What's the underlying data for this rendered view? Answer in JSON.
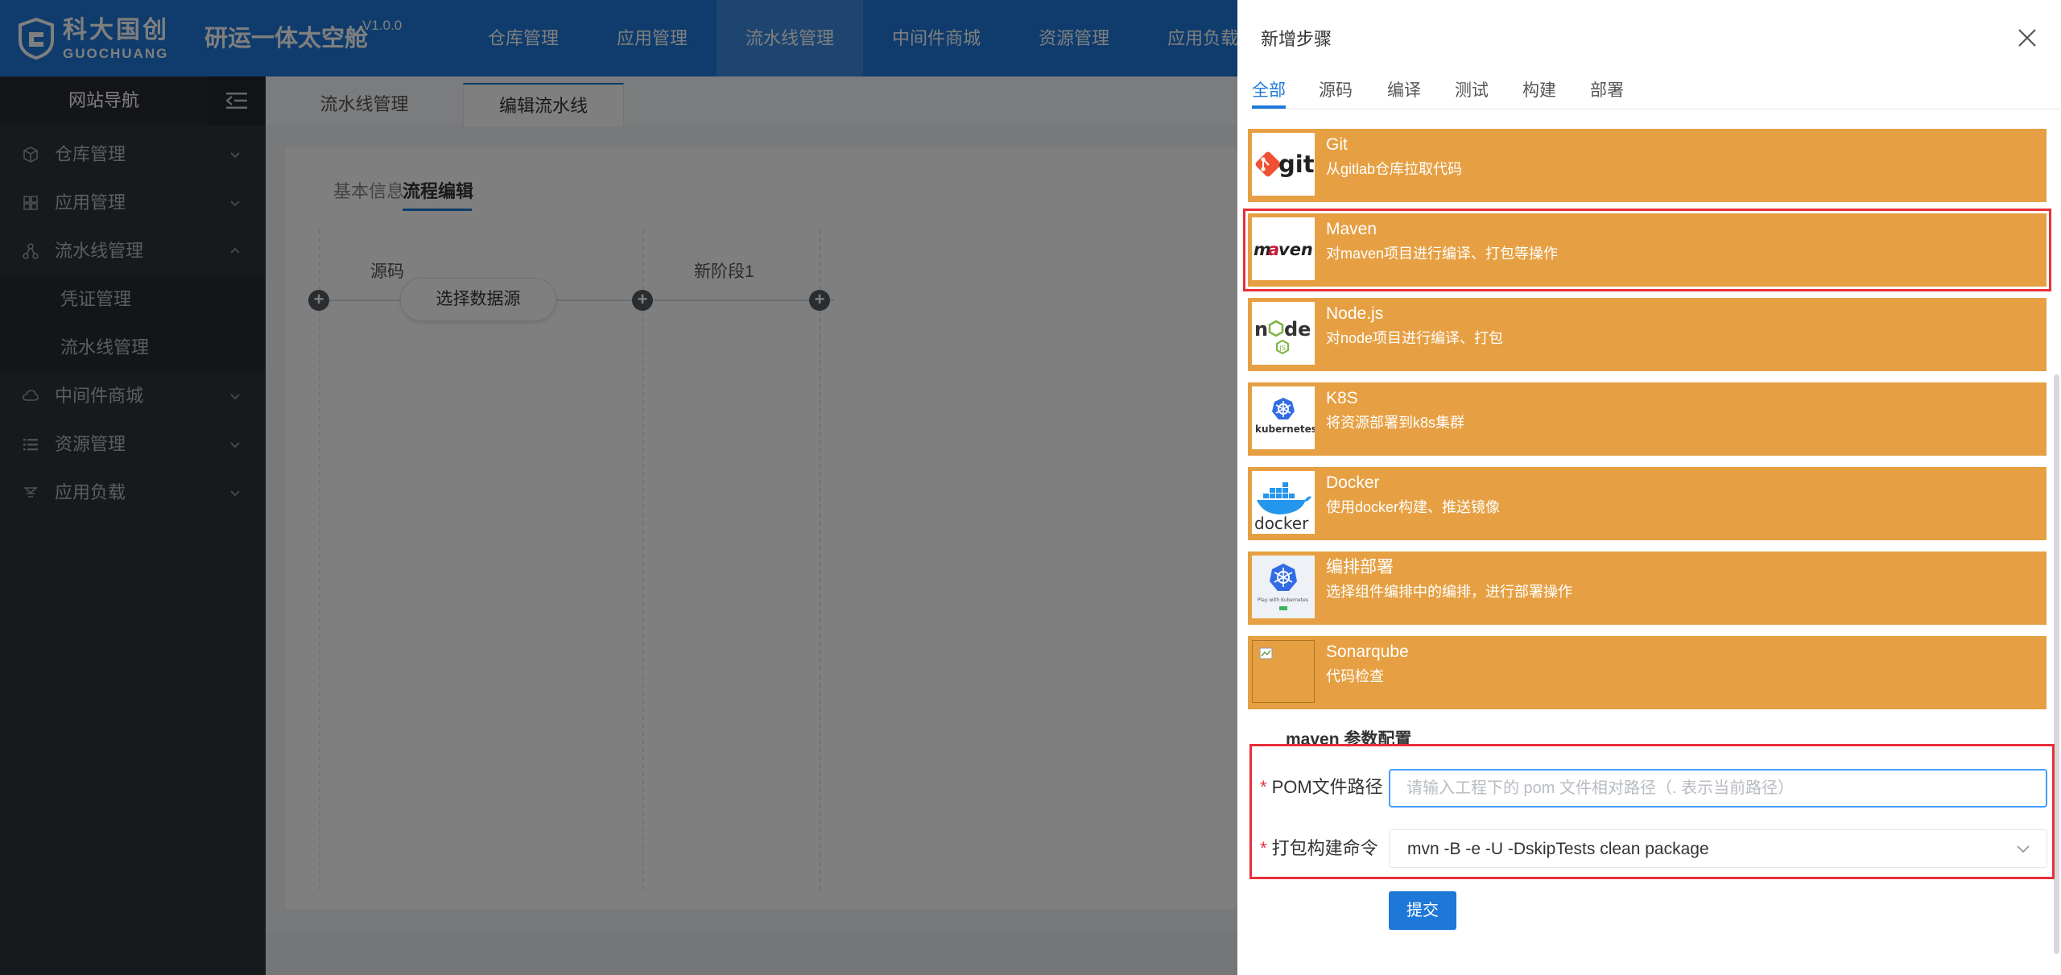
{
  "header": {
    "logo_cn": "科大国创",
    "logo_en": "GUOCHUANG",
    "app_title": "研运一体太空舱",
    "version": "V1.0.0",
    "nav": [
      "仓库管理",
      "应用管理",
      "流水线管理",
      "中间件商城",
      "资源管理",
      "应用负载"
    ],
    "active_nav": "流水线管理"
  },
  "sidebar": {
    "title": "网站导航",
    "items": [
      {
        "label": "仓库管理",
        "icon": "cube-icon"
      },
      {
        "label": "应用管理",
        "icon": "grid-icon"
      },
      {
        "label": "流水线管理",
        "icon": "flow-icon"
      },
      {
        "label": "中间件商城",
        "icon": "cloud-icon"
      },
      {
        "label": "资源管理",
        "icon": "list-icon"
      },
      {
        "label": "应用负载",
        "icon": "load-icon"
      }
    ],
    "subitems": [
      "凭证管理",
      "流水线管理"
    ]
  },
  "main": {
    "tabs": [
      "流水线管理",
      "编辑流水线"
    ],
    "subtabs": [
      "基本信息",
      "流程编辑"
    ],
    "stages": [
      "源码",
      "新阶段1"
    ],
    "select_source": "选择数据源"
  },
  "drawer": {
    "title": "新增步骤",
    "categories": [
      "全部",
      "源码",
      "编译",
      "测试",
      "构建",
      "部署"
    ],
    "steps": [
      {
        "name": "Git",
        "desc": "从gitlab仓库拉取代码",
        "icon": "git-logo"
      },
      {
        "name": "Maven",
        "desc": "对maven项目进行编译、打包等操作",
        "icon": "maven-logo"
      },
      {
        "name": "Node.js",
        "desc": "对node项目进行编译、打包",
        "icon": "nodejs-logo"
      },
      {
        "name": "K8S",
        "desc": "将资源部署到k8s集群",
        "icon": "kubernetes-logo"
      },
      {
        "name": "Docker",
        "desc": "使用docker构建、推送镜像",
        "icon": "docker-logo"
      },
      {
        "name": "编排部署",
        "desc": "选择组件编排中的编排，进行部署操作",
        "icon": "play-with-kubernetes-logo"
      },
      {
        "name": "Sonarqube",
        "desc": "代码检查",
        "icon": "broken-image-icon"
      }
    ],
    "config_title": "maven 参数配置",
    "form": {
      "pom_label": "POM文件路径",
      "pom_placeholder": "请输入工程下的 pom 文件相对路径（. 表示当前路径）",
      "pom_value": "",
      "build_label": "打包构建命令",
      "build_value": "mvn -B -e -U -DskipTests clean package",
      "submit": "提交"
    }
  },
  "colors": {
    "primary": "#1e78d8",
    "step_card": "#e6a043",
    "highlight": "#e8303a",
    "sidebar_bg": "#2e3439"
  }
}
